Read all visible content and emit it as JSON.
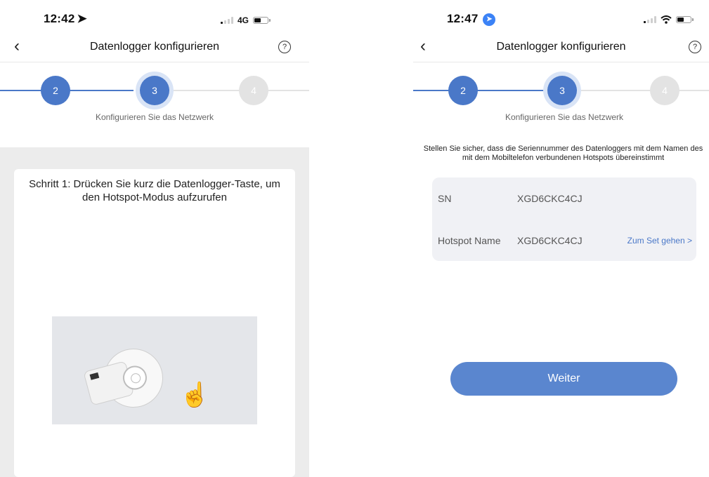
{
  "left_screen": {
    "status_bar": {
      "time": "12:42",
      "location_icon": "location-arrow-icon",
      "network": "4G"
    },
    "nav": {
      "title": "Datenlogger konfigurieren",
      "back_icon": "chevron-left-icon",
      "help_icon": "question-circle-icon",
      "help_glyph": "?"
    },
    "stepper": {
      "steps": [
        "2",
        "3",
        "4"
      ],
      "active_step": "3",
      "caption": "Konfigurieren Sie das Netzwerk"
    },
    "instruction": "Schritt 1: Drücken Sie kurz die Datenlogger-Taste, um den Hotspot-Modus aufzurufen"
  },
  "right_screen": {
    "status_bar": {
      "time": "12:47",
      "location_icon": "location-arrow-icon",
      "wifi_icon": "wifi-icon"
    },
    "nav": {
      "title": "Datenlogger konfigurieren",
      "back_icon": "chevron-left-icon",
      "help_icon": "question-circle-icon",
      "help_glyph": "?"
    },
    "stepper": {
      "steps": [
        "2",
        "3",
        "4"
      ],
      "active_step": "3",
      "caption": "Konfigurieren Sie das Netzwerk"
    },
    "intro": "Stellen Sie sicher, dass die Seriennummer des Datenloggers mit dem Namen des mit dem Mobiltelefon verbundenen Hotspots übereinstimmt",
    "info": {
      "sn_label": "SN",
      "sn_value": "XGD6CKC4CJ",
      "hotspot_label": "Hotspot Name",
      "hotspot_value": "XGD6CKC4CJ",
      "link": "Zum Set gehen >"
    },
    "button": "Weiter"
  },
  "colors": {
    "accent": "#4a78c8",
    "button": "#5a86cf",
    "inactive": "#e3e3e3"
  }
}
